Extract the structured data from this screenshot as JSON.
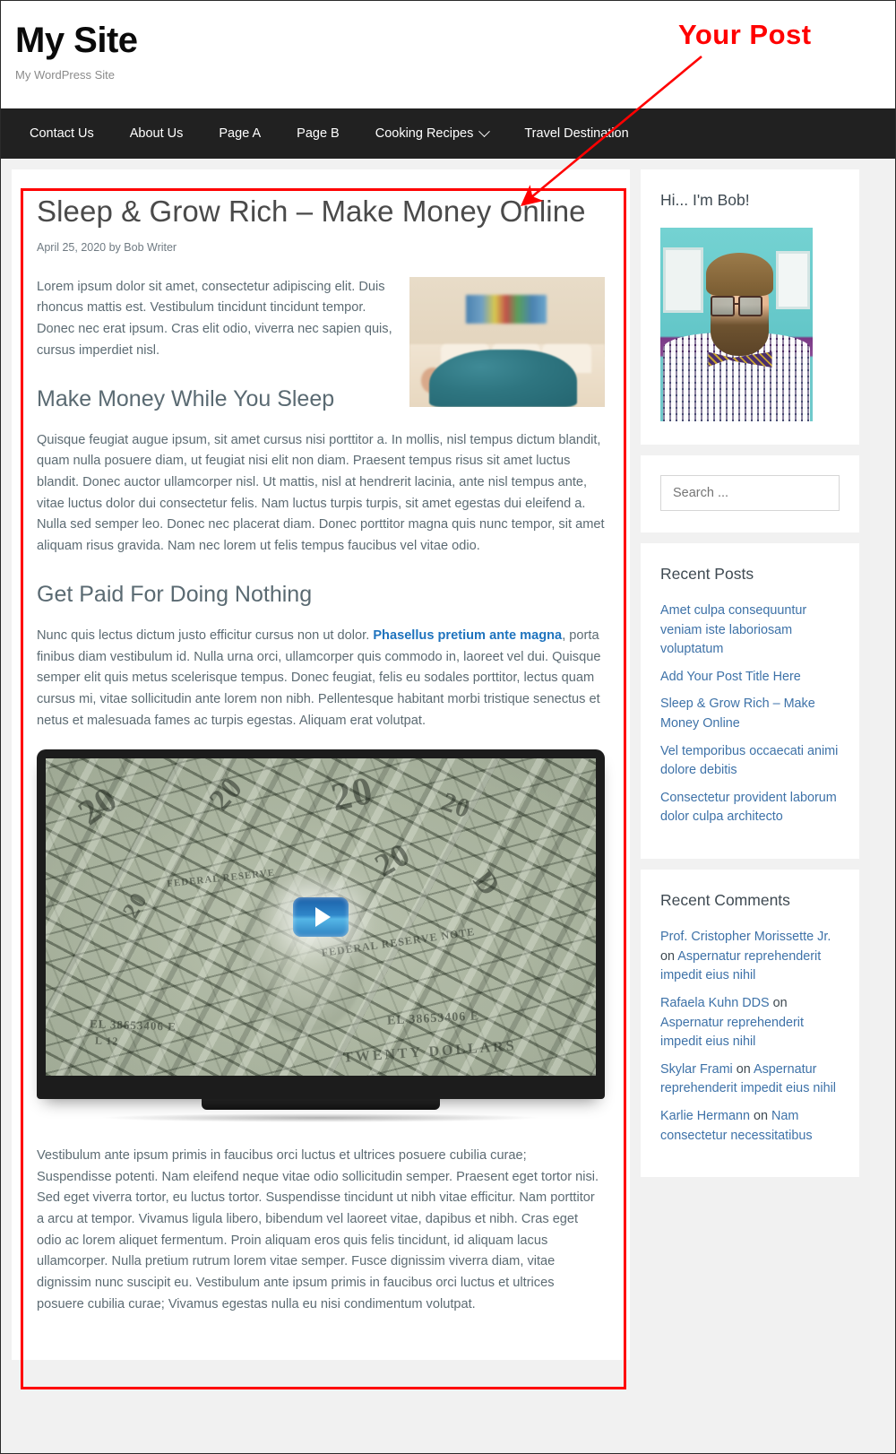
{
  "header": {
    "site_title": "My Site",
    "tagline": "My WordPress Site"
  },
  "nav": {
    "items": [
      {
        "label": "Contact Us",
        "has_dropdown": false
      },
      {
        "label": "About Us",
        "has_dropdown": false
      },
      {
        "label": "Page A",
        "has_dropdown": false
      },
      {
        "label": "Page B",
        "has_dropdown": false
      },
      {
        "label": "Cooking Recipes",
        "has_dropdown": true
      },
      {
        "label": "Travel Destination",
        "has_dropdown": false
      }
    ]
  },
  "annotation": {
    "label": "Your Post",
    "color": "#ff0000"
  },
  "post": {
    "title": "Sleep & Grow Rich – Make Money Online",
    "meta": "April 25, 2020 by Bob Writer",
    "meta_date": "April 25, 2020",
    "meta_author": "Bob Writer",
    "intro": "Lorem ipsum dolor sit amet, consectetur adipiscing elit. Duis rhoncus mattis est. Vestibulum tincidunt tincidunt tempor. Donec nec erat ipsum. Cras elit odio, viverra nec sapien quis, cursus imperdiet nisl.",
    "heading_1": "Make Money While You Sleep",
    "paragraph_1": "Quisque feugiat augue ipsum, sit amet cursus nisi porttitor a. In mollis, nisl tempus dictum blandit, quam nulla posuere diam, ut feugiat nisi elit non diam. Praesent tempus risus sit amet luctus blandit. Donec auctor ullamcorper nisl. Ut mattis, nisl at hendrerit lacinia, ante nisl tempus ante, vitae luctus dolor dui consectetur felis. Nam luctus turpis turpis, sit amet egestas dui eleifend a. Nulla sed semper leo. Donec nec placerat diam. Donec porttitor magna quis nunc tempor, sit amet aliquam risus gravida. Nam nec lorem ut felis tempus faucibus vel vitae odio.",
    "heading_2": "Get Paid For Doing Nothing",
    "paragraph_2_before": "Nunc quis lectus dictum justo efficitur cursus non ut dolor. ",
    "paragraph_2_link": "Phasellus pretium ante magna",
    "paragraph_2_after": ", porta finibus diam vestibulum id. Nulla urna orci, ullamcorper quis commodo in, laoreet vel dui. Quisque semper elit quis metus scelerisque tempus. Donec feugiat, felis eu sodales porttitor, lectus quam cursus mi, vitae sollicitudin ante lorem non nibh. Pellentesque habitant morbi tristique senectus et netus et malesuada fames ac turpis egestas. Aliquam erat volutpat.",
    "paragraph_3": "Vestibulum ante ipsum primis in faucibus orci luctus et ultrices posuere cubilia curae; Suspendisse potenti. Nam eleifend neque vitae odio sollicitudin semper. Praesent eget tortor nisi. Sed eget viverra tortor, eu luctus tortor. Suspendisse tincidunt ut nibh vitae efficitur. Nam porttitor a arcu at tempor. Vivamus ligula libero, bibendum vel laoreet vitae, dapibus et nibh. Cras eget odio ac lorem aliquet fermentum. Proin aliquam eros quis felis tincidunt, id aliquam lacus ullamcorper. Nulla pretium rutrum lorem vitae semper. Fusce dignissim viverra diam, vitae dignissim nunc suscipit eu. Vestibulum ante ipsum primis in faucibus orci luctus et ultrices posuere cubilia curae; Vivamus egestas nulla eu nisi condimentum volutpat.",
    "feature_image_alt": "person sleeping on couch under teal blanket",
    "video": {
      "alt": "computer monitor filled with twenty dollar bills",
      "play_icon": "play-icon"
    }
  },
  "sidebar": {
    "about": {
      "title": "Hi... I'm Bob!",
      "avatar_alt": "bearded man with glasses and bow tie"
    },
    "search": {
      "placeholder": "Search ...",
      "value": ""
    },
    "recent_posts": {
      "title": "Recent Posts",
      "items": [
        "Amet culpa consequuntur veniam iste laboriosam voluptatum",
        "Add Your Post Title Here",
        "Sleep & Grow Rich – Make Money Online",
        "Vel temporibus occaecati animi dolore debitis",
        "Consectetur provident laborum dolor culpa architecto"
      ]
    },
    "recent_comments": {
      "title": "Recent Comments",
      "on_label": "on",
      "items": [
        {
          "author": "Prof. Cristopher Morissette Jr.",
          "post": "Aspernatur reprehenderit impedit eius nihil"
        },
        {
          "author": "Rafaela Kuhn DDS",
          "post": "Aspernatur reprehenderit impedit eius nihil"
        },
        {
          "author": "Skylar Frami",
          "post": "Aspernatur reprehenderit impedit eius nihil"
        },
        {
          "author": "Karlie Hermann",
          "post": "Nam consectetur necessitatibus"
        }
      ]
    }
  }
}
